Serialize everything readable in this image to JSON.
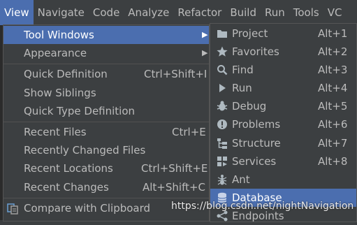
{
  "menubar": {
    "items": [
      "View",
      "Navigate",
      "Code",
      "Analyze",
      "Refactor",
      "Build",
      "Run",
      "Tools",
      "VC"
    ]
  },
  "view_menu": {
    "items": [
      {
        "label": "Tool Windows",
        "shortcut": ""
      },
      {
        "label": "Appearance",
        "shortcut": ""
      },
      {
        "label": "Quick Definition",
        "shortcut": "Ctrl+Shift+I"
      },
      {
        "label": "Show Siblings",
        "shortcut": ""
      },
      {
        "label": "Quick Type Definition",
        "shortcut": ""
      },
      {
        "label": "Recent Files",
        "shortcut": "Ctrl+E"
      },
      {
        "label": "Recently Changed Files",
        "shortcut": ""
      },
      {
        "label": "Recent Locations",
        "shortcut": "Ctrl+Shift+E"
      },
      {
        "label": "Recent Changes",
        "shortcut": "Alt+Shift+C"
      },
      {
        "label": "Compare with Clipboard",
        "shortcut": ""
      }
    ]
  },
  "tool_windows_menu": {
    "items": [
      {
        "label": "Project",
        "shortcut": "Alt+1",
        "icon": "folder-icon"
      },
      {
        "label": "Favorites",
        "shortcut": "Alt+2",
        "icon": "star-icon"
      },
      {
        "label": "Find",
        "shortcut": "Alt+3",
        "icon": "search-icon"
      },
      {
        "label": "Run",
        "shortcut": "Alt+4",
        "icon": "play-icon"
      },
      {
        "label": "Debug",
        "shortcut": "Alt+5",
        "icon": "bug-icon"
      },
      {
        "label": "Problems",
        "shortcut": "Alt+6",
        "icon": "warning-icon"
      },
      {
        "label": "Structure",
        "shortcut": "Alt+7",
        "icon": "structure-icon"
      },
      {
        "label": "Services",
        "shortcut": "Alt+8",
        "icon": "services-icon"
      },
      {
        "label": "Ant",
        "shortcut": "",
        "icon": "ant-icon"
      },
      {
        "label": "Database",
        "shortcut": "",
        "icon": "database-icon"
      },
      {
        "label": "Endpoints",
        "shortcut": "",
        "icon": "endpoints-icon"
      }
    ]
  },
  "watermark": "https://blog.csdn.net/nightNavigation",
  "colors": {
    "background": "#3c3f41",
    "highlight": "#4b6eaf",
    "text": "#bbbbbb",
    "separator": "#515151"
  }
}
